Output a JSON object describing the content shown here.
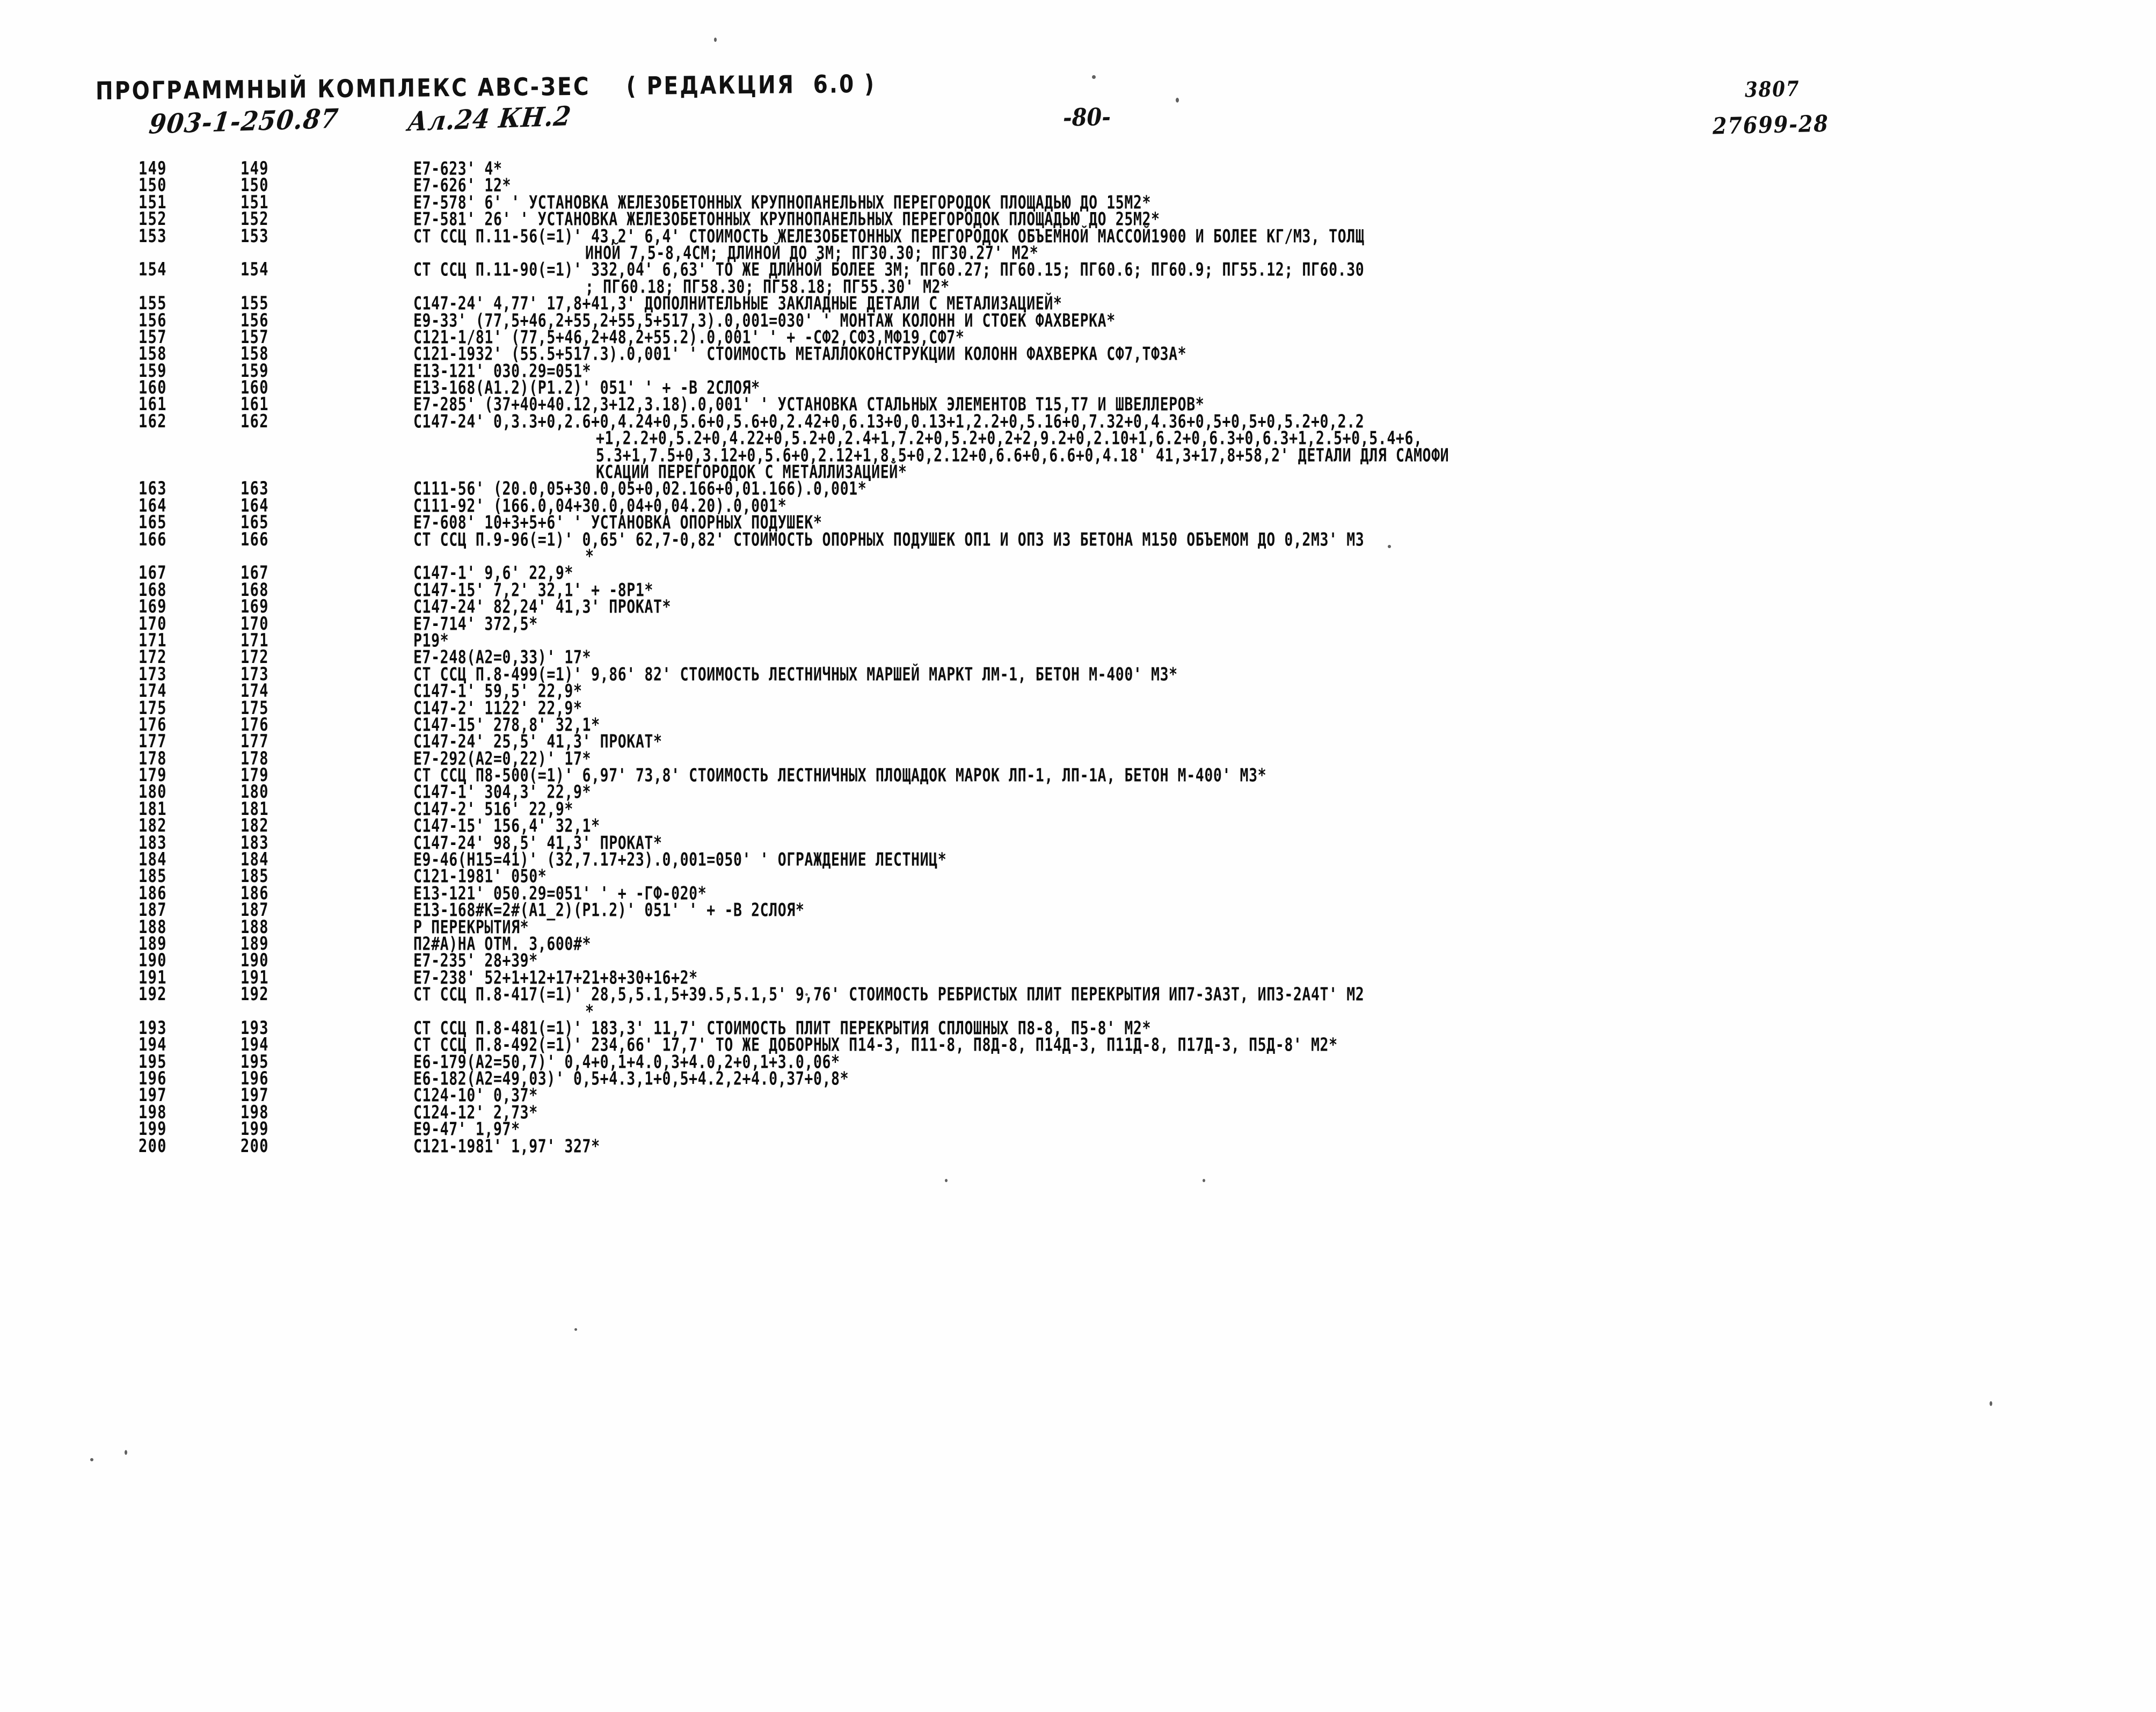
{
  "header": {
    "program_line": "ПРОГРАММНЫЙ КОМПЛЕКС АВС-ЗЕС    ( РЕДАКЦИЯ  6.0 )",
    "project_code": "903-1-250.87",
    "album": "Ал.24 КН.2",
    "page_number": "-80-",
    "stamp_top": "3807",
    "stamp_bottom": "27699-28"
  },
  "listing": {
    "rows": [
      {
        "a": "149",
        "b": "149",
        "text": "E7-623' 4*",
        "indent": "normal"
      },
      {
        "a": "150",
        "b": "150",
        "text": "E7-626' 12*",
        "indent": "normal"
      },
      {
        "a": "151",
        "b": "151",
        "text": "E7-578' 6' ' УСТАНОВКА ЖЕЛЕЗОБЕТОННЫХ КРУПНОПАНЕЛЬНЫХ ПЕРЕГОРОДОК ПЛОЩАДЬЮ ДО 15М2*",
        "indent": "normal"
      },
      {
        "a": "152",
        "b": "152",
        "text": "E7-581' 26' ' УСТАНОВКА ЖЕЛЕЗОБЕТОННЫХ КРУПНОПАНЕЛЬНЫХ ПЕРЕГОРОДОК ПЛОЩАДЬЮ ДО 25М2*",
        "indent": "normal"
      },
      {
        "a": "153",
        "b": "153",
        "text": "СТ ССЦ П.11-56(=1)' 43,2' 6,4' СТОИМОСТЬ ЖЕЛЕЗОБЕТОННЫХ ПЕРЕГОРОДОК ОБЪЕМНОЙ МАССОЙ1900 И БОЛЕЕ КГ/М3, ТОЛЩ",
        "indent": "normal"
      },
      {
        "a": "",
        "b": "",
        "text": "ИНОЙ 7,5-8,4СМ; ДЛИНОЙ ДО 3М; ПГ30.30; ПГ30.27' М2*",
        "indent": "cont"
      },
      {
        "a": "154",
        "b": "154",
        "text": "СТ ССЦ П.11-90(=1)' 332,04' 6,63' ТО ЖЕ ДЛИНОЙ БОЛЕЕ 3М; ПГ60.27; ПГ60.15; ПГ60.6; ПГ60.9; ПГ55.12; ПГ60.30",
        "indent": "normal"
      },
      {
        "a": "",
        "b": "",
        "text": "; ПГ60.18; ПГ58.30; ПГ58.18; ПГ55.30' М2*",
        "indent": "cont"
      },
      {
        "a": "155",
        "b": "155",
        "text": "C147-24' 4,77' 17,8+41,3' ДОПОЛНИТЕЛЬНЫЕ ЗАКЛАДНЫЕ ДЕТАЛИ С МЕТАЛИЗАЦИЕЙ*",
        "indent": "normal"
      },
      {
        "a": "156",
        "b": "156",
        "text": "E9-33' (77,5+46,2+55,2+55,5+517,3).0,001=030' ' МОНТАЖ КОЛОНН И СТОЕК ФАХВЕРКА*",
        "indent": "normal"
      },
      {
        "a": "157",
        "b": "157",
        "text": "C121-1/81' (77,5+46,2+48,2+55.2).0,001' ' + -СФ2,СФ3,МФ19,СФ7*",
        "indent": "normal"
      },
      {
        "a": "158",
        "b": "158",
        "text": "C121-1932' (55.5+517.3).0,001' ' СТОИМОСТЬ МЕТАЛЛОКОНСТРУКЦИИ КОЛОНН ФАХВЕРКА СФ7,ТФЗА*",
        "indent": "normal"
      },
      {
        "a": "159",
        "b": "159",
        "text": "E13-121' 030.29=051*",
        "indent": "normal"
      },
      {
        "a": "160",
        "b": "160",
        "text": "E13-168(A1.2)(P1.2)' 051' ' + -В 2СЛОЯ*",
        "indent": "normal"
      },
      {
        "a": "161",
        "b": "161",
        "text": "E7-285' (37+40+40.12,3+12,3.18).0,001' ' УСТАНОВКА СТАЛЬНЫХ ЭЛЕМЕНТОВ Т15,Т7 И ШВЕЛЛЕРОВ*",
        "indent": "normal"
      },
      {
        "a": "162",
        "b": "162",
        "text": "C147-24' 0,3.3+0,2.6+0,4.24+0,5.6+0,5.6+0,2.42+0,6.13+0,0.13+1,2.2+0,5.16+0,7.32+0,4.36+0,5+0,5+0,5.2+0,2.2",
        "indent": "normal"
      },
      {
        "a": "",
        "b": "",
        "text": "+1,2.2+0,5.2+0,4.22+0,5.2+0,2.4+1,7.2+0,5.2+0,2+2,9.2+0,2.10+1,6.2+0,6.3+0,6.3+1,2.5+0,5.4+6,",
        "indent": "cont2"
      },
      {
        "a": "",
        "b": "",
        "text": "5.3+1,7.5+0,3.12+0,5.6+0,2.12+1,8.5+0,2.12+0,6.6+0,6.6+0,4.18' 41,3+17,8+58,2' ДЕТАЛИ ДЛЯ САМОФИ",
        "indent": "cont2"
      },
      {
        "a": "",
        "b": "",
        "text": "КСАЦИИ ПЕРЕГОРОДОК С МЕТАЛЛИЗАЦИЕЙ*",
        "indent": "cont2"
      },
      {
        "a": "163",
        "b": "163",
        "text": "C111-56' (20.0,05+30.0,05+0,02.166+0,01.166).0,001*",
        "indent": "normal"
      },
      {
        "a": "164",
        "b": "164",
        "text": "C111-92' (166.0,04+30.0,04+0,04.20).0,001*",
        "indent": "normal"
      },
      {
        "a": "165",
        "b": "165",
        "text": "E7-608' 10+3+5+6' ' УСТАНОВКА ОПОРНЫХ ПОДУШЕК*",
        "indent": "normal"
      },
      {
        "a": "166",
        "b": "166",
        "text": "СТ ССЦ П.9-96(=1)' 0,65' 62,7-0,82' СТОИМОСТЬ ОПОРНЫХ ПОДУШЕК ОП1 И ОП3 ИЗ БЕТОНА М150 ОБЪЕМОМ ДО 0,2М3' М3",
        "indent": "normal"
      },
      {
        "a": "",
        "b": "",
        "text": "*",
        "indent": "star"
      },
      {
        "a": "167",
        "b": "167",
        "text": "C147-1' 9,6' 22,9*",
        "indent": "normal"
      },
      {
        "a": "168",
        "b": "168",
        "text": "C147-15' 7,2' 32,1' + -8P1*",
        "indent": "normal"
      },
      {
        "a": "169",
        "b": "169",
        "text": "C147-24' 82,24' 41,3' ПРОКАТ*",
        "indent": "normal"
      },
      {
        "a": "170",
        "b": "170",
        "text": "E7-714' 372,5*",
        "indent": "normal"
      },
      {
        "a": "171",
        "b": "171",
        "text": "P19*",
        "indent": "normal"
      },
      {
        "a": "172",
        "b": "172",
        "text": "E7-248(A2=0,33)' 17*",
        "indent": "normal"
      },
      {
        "a": "173",
        "b": "173",
        "text": "СТ ССЦ П.8-499(=1)' 9,86' 82' СТОИМОСТЬ ЛЕСТНИЧНЫХ МАРШЕЙ МАРКТ ЛМ-1, БЕТОН М-400' М3*",
        "indent": "normal"
      },
      {
        "a": "174",
        "b": "174",
        "text": "C147-1' 59,5' 22,9*",
        "indent": "normal"
      },
      {
        "a": "175",
        "b": "175",
        "text": "C147-2' 1122' 22,9*",
        "indent": "normal"
      },
      {
        "a": "176",
        "b": "176",
        "text": "C147-15' 278,8' 32,1*",
        "indent": "normal"
      },
      {
        "a": "177",
        "b": "177",
        "text": "C147-24' 25,5' 41,3' ПРОКАТ*",
        "indent": "normal"
      },
      {
        "a": "178",
        "b": "178",
        "text": "E7-292(A2=0,22)' 17*",
        "indent": "normal"
      },
      {
        "a": "179",
        "b": "179",
        "text": "СТ ССЦ П8-500(=1)' 6,97' 73,8' СТОИМОСТЬ ЛЕСТНИЧНЫХ ПЛОЩАДОК МАРОК ЛП-1, ЛП-1А, БЕТОН М-400' М3*",
        "indent": "normal"
      },
      {
        "a": "180",
        "b": "180",
        "text": "C147-1' 304,3' 22,9*",
        "indent": "normal"
      },
      {
        "a": "181",
        "b": "181",
        "text": "C147-2' 516' 22,9*",
        "indent": "normal"
      },
      {
        "a": "182",
        "b": "182",
        "text": "C147-15' 156,4' 32,1*",
        "indent": "normal"
      },
      {
        "a": "183",
        "b": "183",
        "text": "C147-24' 98,5' 41,3' ПРОКАТ*",
        "indent": "normal"
      },
      {
        "a": "184",
        "b": "184",
        "text": "E9-46(H15=41)' (32,7.17+23).0,001=050' ' ОГРАЖДЕНИЕ ЛЕСТНИЦ*",
        "indent": "normal"
      },
      {
        "a": "185",
        "b": "185",
        "text": "C121-1981' 050*",
        "indent": "normal"
      },
      {
        "a": "186",
        "b": "186",
        "text": "E13-121' 050.29=051' ' + -ГФ-020*",
        "indent": "normal"
      },
      {
        "a": "187",
        "b": "187",
        "text": "E13-168#K=2#(A1_2)(P1.2)' 051' ' + -В 2СЛОЯ*",
        "indent": "normal"
      },
      {
        "a": "188",
        "b": "188",
        "text": "P ПЕРЕКРЫТИЯ*",
        "indent": "normal"
      },
      {
        "a": "189",
        "b": "189",
        "text": "П2#А)НА ОТМ. 3,600#*",
        "indent": "normal"
      },
      {
        "a": "190",
        "b": "190",
        "text": "E7-235' 28+39*",
        "indent": "normal"
      },
      {
        "a": "191",
        "b": "191",
        "text": "E7-238' 52+1+12+17+21+8+30+16+2*",
        "indent": "normal"
      },
      {
        "a": "192",
        "b": "192",
        "text": "СТ ССЦ П.8-417(=1)' 28,5,5.1,5+39.5,5.1,5' 9,76' СТОИМОСТЬ РЕБРИСТЫХ ПЛИТ ПЕРЕКРЫТИЯ ИП7-3А3Т, ИП3-2А4Т' М2",
        "indent": "normal"
      },
      {
        "a": "",
        "b": "",
        "text": "*",
        "indent": "star"
      },
      {
        "a": "193",
        "b": "193",
        "text": "СТ ССЦ П.8-481(=1)' 183,3' 11,7' СТОИМОСТЬ ПЛИТ ПЕРЕКРЫТИЯ СПЛОШНЫХ П8-8, П5-8' М2*",
        "indent": "normal"
      },
      {
        "a": "194",
        "b": "194",
        "text": "СТ ССЦ П.8-492(=1)' 234,66' 17,7' ТО ЖЕ ДОБОРНЫХ П14-3, П11-8, П8Д-8, П14Д-3, П11Д-8, П17Д-3, П5Д-8' М2*",
        "indent": "normal"
      },
      {
        "a": "195",
        "b": "195",
        "text": "E6-179(A2=50,7)' 0,4+0,1+4.0,3+4.0,2+0,1+3.0,06*",
        "indent": "normal"
      },
      {
        "a": "196",
        "b": "196",
        "text": "E6-182(A2=49,03)' 0,5+4.3,1+0,5+4.2,2+4.0,37+0,8*",
        "indent": "normal"
      },
      {
        "a": "197",
        "b": "197",
        "text": "C124-10' 0,37*",
        "indent": "normal"
      },
      {
        "a": "198",
        "b": "198",
        "text": "C124-12' 2,73*",
        "indent": "normal"
      },
      {
        "a": "199",
        "b": "199",
        "text": "E9-47' 1,97*",
        "indent": "normal"
      },
      {
        "a": "200",
        "b": "200",
        "text": "C121-1981' 1,97' 327*",
        "indent": "normal"
      }
    ]
  },
  "colors": {
    "ink": "#0d0d0d",
    "paper": "#fefefe"
  }
}
